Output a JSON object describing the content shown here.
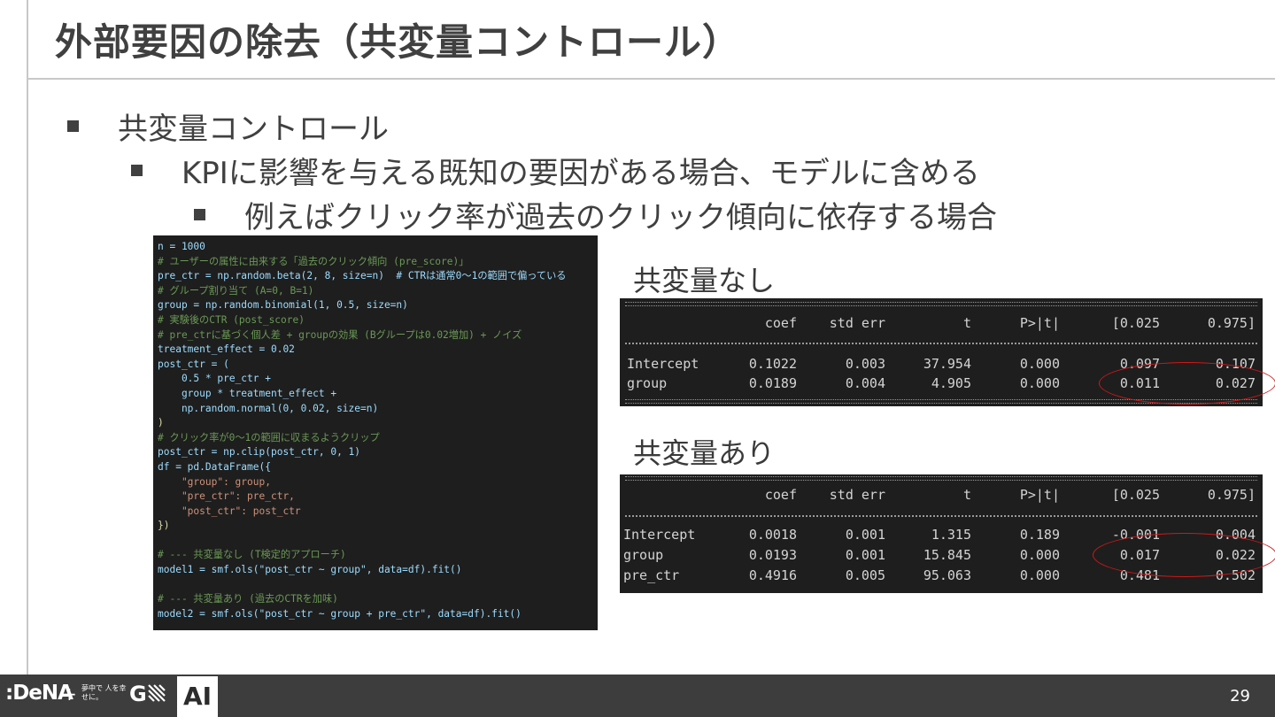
{
  "title": "外部要因の除去（共変量コントロール）",
  "bullets": {
    "l1": "共変量コントロール",
    "l2": "KPIに影響を与える既知の要因がある場合、モデルに含める",
    "l3": "例えばクリック率が過去のクリック傾向に依存する場合"
  },
  "code_lines": [
    {
      "t": "n = 1000",
      "c": "def"
    },
    {
      "t": "# ユーザーの属性に由来する「過去のクリック傾向 (pre_score)」",
      "c": "cm"
    },
    {
      "t": "pre_ctr = np.random.beta(2, 8, size=n)  # CTRは通常0〜1の範囲で偏っている",
      "c": "def"
    },
    {
      "t": "# グループ割り当て (A=0, B=1)",
      "c": "cm"
    },
    {
      "t": "group = np.random.binomial(1, 0.5, size=n)",
      "c": "def"
    },
    {
      "t": "# 実験後のCTR (post_score)",
      "c": "cm"
    },
    {
      "t": "# pre_ctrに基づく個人差 + groupの効果 (Bグループは0.02増加) + ノイズ",
      "c": "cm"
    },
    {
      "t": "treatment_effect = 0.02",
      "c": "def"
    },
    {
      "t": "post_ctr = (",
      "c": "def"
    },
    {
      "t": "    0.5 * pre_ctr +",
      "c": "def"
    },
    {
      "t": "    group * treatment_effect +",
      "c": "def"
    },
    {
      "t": "    np.random.normal(0, 0.02, size=n)",
      "c": "def"
    },
    {
      "t": ")",
      "c": "fn"
    },
    {
      "t": "# クリック率が0〜1の範囲に収まるようクリップ",
      "c": "cm"
    },
    {
      "t": "post_ctr = np.clip(post_ctr, 0, 1)",
      "c": "def"
    },
    {
      "t": "df = pd.DataFrame({",
      "c": "def"
    },
    {
      "t": "    \"group\": group,",
      "c": "str"
    },
    {
      "t": "    \"pre_ctr\": pre_ctr,",
      "c": "str"
    },
    {
      "t": "    \"post_ctr\": post_ctr",
      "c": "str"
    },
    {
      "t": "})",
      "c": "fn"
    },
    {
      "t": "",
      "c": "def"
    },
    {
      "t": "# --- 共変量なし (T検定的アプローチ)",
      "c": "cm"
    },
    {
      "t": "model1 = smf.ols(\"post_ctr ~ group\", data=df).fit()",
      "c": "def"
    },
    {
      "t": "",
      "c": "def"
    },
    {
      "t": "# --- 共変量あり (過去のCTRを加味)",
      "c": "cm"
    },
    {
      "t": "model2 = smf.ols(\"post_ctr ~ group + pre_ctr\", data=df).fit()",
      "c": "def"
    }
  ],
  "label_without": "共変量なし",
  "label_with": "共変量あり",
  "table_headers": [
    "",
    "coef",
    "std err",
    "t",
    "P>|t|",
    "[0.025",
    "0.975]"
  ],
  "table1_rows": [
    [
      "Intercept",
      "0.1022",
      "0.003",
      "37.954",
      "0.000",
      "0.097",
      "0.107"
    ],
    [
      "group",
      "0.0189",
      "0.004",
      "4.905",
      "0.000",
      "0.011",
      "0.027"
    ]
  ],
  "table2_rows": [
    [
      "Intercept",
      "0.0018",
      "0.001",
      "1.315",
      "0.189",
      "-0.001",
      "0.004"
    ],
    [
      "group",
      "0.0193",
      "0.001",
      "15.845",
      "0.000",
      "0.017",
      "0.022"
    ],
    [
      "pre_ctr",
      "0.4916",
      "0.005",
      "95.063",
      "0.000",
      "0.481",
      "0.502"
    ]
  ],
  "footer": {
    "logo": ":DeNA",
    "plus": "+",
    "tagline": "夢中で 人を幸せに。",
    "gn": "G",
    "ai": "AI",
    "page_number": "29"
  },
  "colors": {
    "highlight_ellipse": "#d01818",
    "code_bg": "#1e1e1e",
    "footer_bg": "#3d3d3d"
  }
}
